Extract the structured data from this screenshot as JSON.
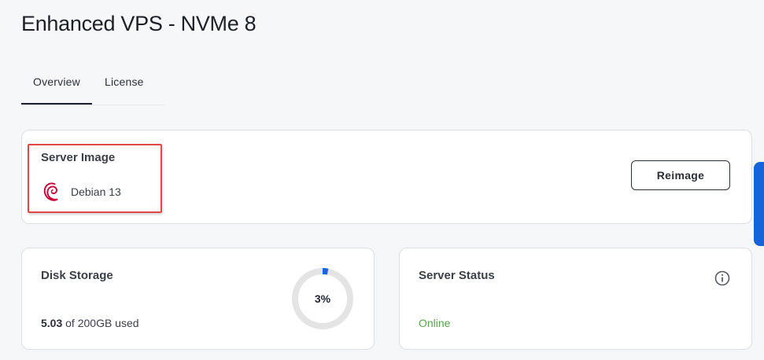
{
  "page": {
    "title": "Enhanced VPS - NVMe 8"
  },
  "tabs": [
    {
      "label": "Overview",
      "active": true
    },
    {
      "label": "License",
      "active": false
    }
  ],
  "server_image": {
    "heading": "Server Image",
    "os_name": "Debian 13",
    "os_icon": "debian-logo",
    "reimage_label": "Reimage"
  },
  "disk": {
    "heading": "Disk Storage",
    "used_value": "5.03",
    "used_suffix": " of 200GB used",
    "percent_label": "3%",
    "percent": 3
  },
  "status": {
    "heading": "Server Status",
    "value": "Online",
    "icon": "info-icon"
  },
  "colors": {
    "accent": "#1664d9",
    "highlight": "#e04848",
    "online": "#5aa34d",
    "debian": "#c70036",
    "donut_track": "#e4e4e4"
  }
}
